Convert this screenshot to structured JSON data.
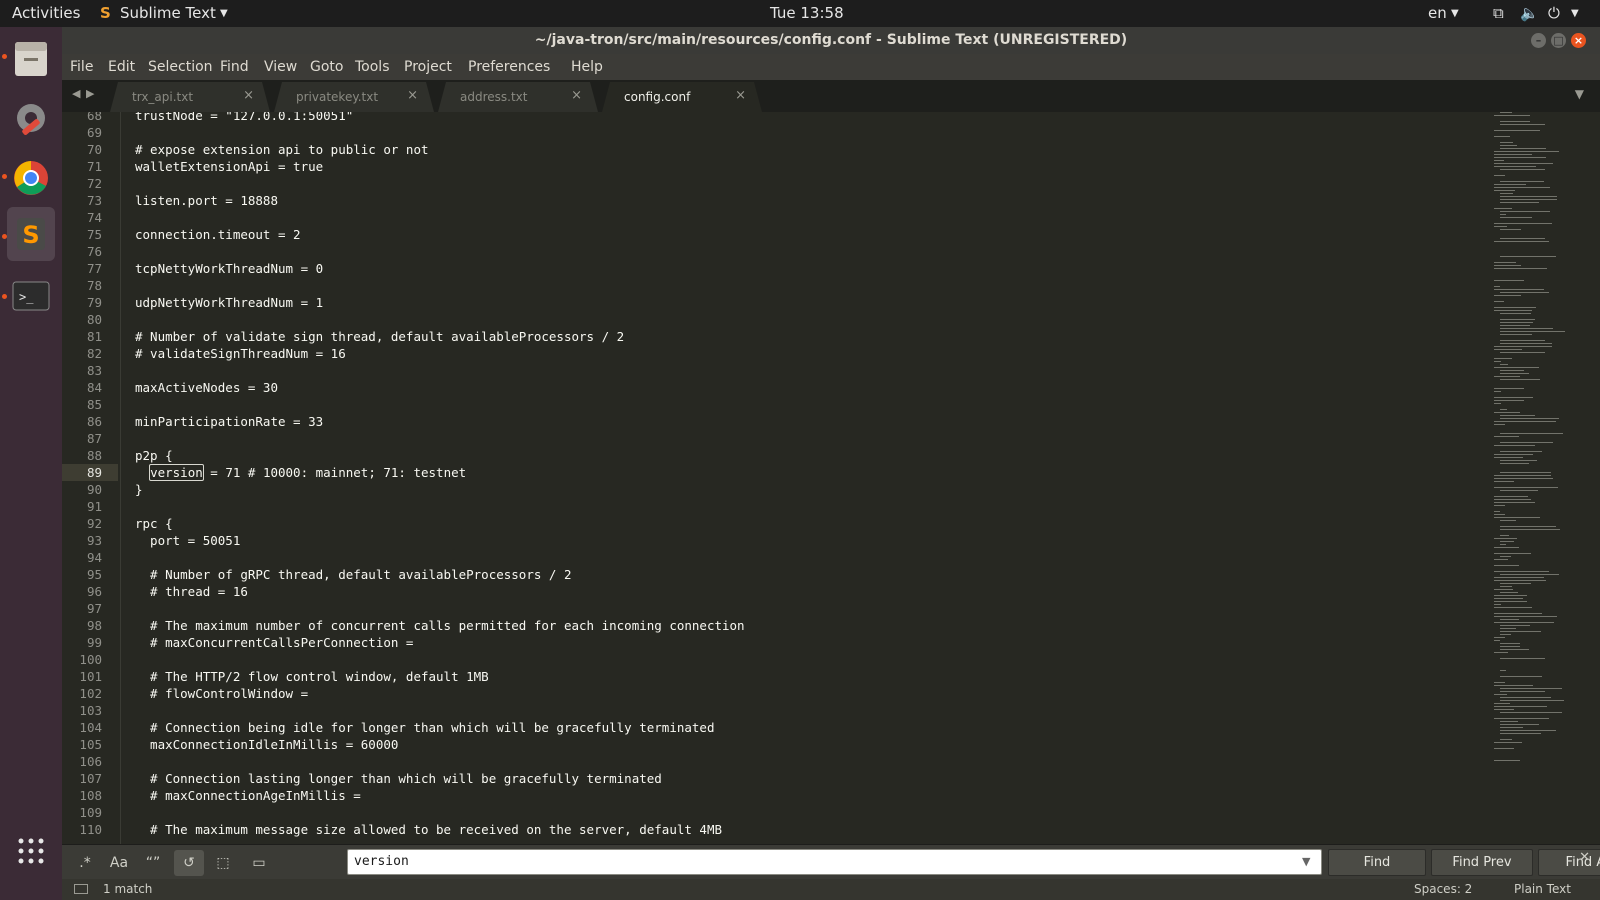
{
  "topbar": {
    "activities": "Activities",
    "app_name": "Sublime Text",
    "clock": "Tue 13:58",
    "lang": "en"
  },
  "window": {
    "title": "~/java-tron/src/main/resources/config.conf - Sublime Text (UNREGISTERED)"
  },
  "menu": [
    "File",
    "Edit",
    "Selection",
    "Find",
    "View",
    "Goto",
    "Tools",
    "Project",
    "Preferences",
    "Help"
  ],
  "tabs": [
    {
      "label": "trx_api.txt",
      "active": false
    },
    {
      "label": "privatekey.txt",
      "active": false
    },
    {
      "label": "address.txt",
      "active": false
    },
    {
      "label": "config.conf",
      "active": true
    }
  ],
  "editor": {
    "current_line": 89,
    "lines": [
      {
        "n": "68",
        "text": "trustNode = \"127.0.0.1:50051\""
      },
      {
        "n": "69",
        "text": ""
      },
      {
        "n": "70",
        "text": "# expose extension api to public or not"
      },
      {
        "n": "71",
        "text": "walletExtensionApi = true"
      },
      {
        "n": "72",
        "text": ""
      },
      {
        "n": "73",
        "text": "listen.port = 18888"
      },
      {
        "n": "74",
        "text": ""
      },
      {
        "n": "75",
        "text": "connection.timeout = 2"
      },
      {
        "n": "76",
        "text": ""
      },
      {
        "n": "77",
        "text": "tcpNettyWorkThreadNum = 0"
      },
      {
        "n": "78",
        "text": ""
      },
      {
        "n": "79",
        "text": "udpNettyWorkThreadNum = 1"
      },
      {
        "n": "80",
        "text": ""
      },
      {
        "n": "81",
        "text": "# Number of validate sign thread, default availableProcessors / 2"
      },
      {
        "n": "82",
        "text": "# validateSignThreadNum = 16"
      },
      {
        "n": "83",
        "text": ""
      },
      {
        "n": "84",
        "text": "maxActiveNodes = 30"
      },
      {
        "n": "85",
        "text": ""
      },
      {
        "n": "86",
        "text": "minParticipationRate = 33"
      },
      {
        "n": "87",
        "text": ""
      },
      {
        "n": "88",
        "text": "p2p {"
      },
      {
        "n": "89",
        "text": "  version = 71 # 10000: mainnet; 71: testnet"
      },
      {
        "n": "90",
        "text": "}"
      },
      {
        "n": "91",
        "text": ""
      },
      {
        "n": "92",
        "text": "rpc {"
      },
      {
        "n": "93",
        "text": "  port = 50051"
      },
      {
        "n": "94",
        "text": ""
      },
      {
        "n": "95",
        "text": "  # Number of gRPC thread, default availableProcessors / 2"
      },
      {
        "n": "96",
        "text": "  # thread = 16"
      },
      {
        "n": "97",
        "text": ""
      },
      {
        "n": "98",
        "text": "  # The maximum number of concurrent calls permitted for each incoming connection"
      },
      {
        "n": "99",
        "text": "  # maxConcurrentCallsPerConnection ="
      },
      {
        "n": "100",
        "text": ""
      },
      {
        "n": "101",
        "text": "  # The HTTP/2 flow control window, default 1MB"
      },
      {
        "n": "102",
        "text": "  # flowControlWindow ="
      },
      {
        "n": "103",
        "text": ""
      },
      {
        "n": "104",
        "text": "  # Connection being idle for longer than which will be gracefully terminated"
      },
      {
        "n": "105",
        "text": "  maxConnectionIdleInMillis = 60000"
      },
      {
        "n": "106",
        "text": ""
      },
      {
        "n": "107",
        "text": "  # Connection lasting longer than which will be gracefully terminated"
      },
      {
        "n": "108",
        "text": "  # maxConnectionAgeInMillis ="
      },
      {
        "n": "109",
        "text": ""
      },
      {
        "n": "110",
        "text": "  # The maximum message size allowed to be received on the server, default 4MB"
      }
    ]
  },
  "find": {
    "query": "version",
    "find_label": "Find",
    "find_prev_label": "Find Prev",
    "find_all_label": "Find All",
    "options": [
      ".*",
      "Aa",
      "“”",
      "↺",
      "⬚",
      "▭"
    ]
  },
  "status": {
    "matches": "1 match",
    "indent": "Spaces: 2",
    "syntax": "Plain Text"
  },
  "colors": {
    "editor_bg": "#272822",
    "text": "#f8f8f2",
    "gutter_text": "#90908a",
    "accent": "#e95420"
  }
}
